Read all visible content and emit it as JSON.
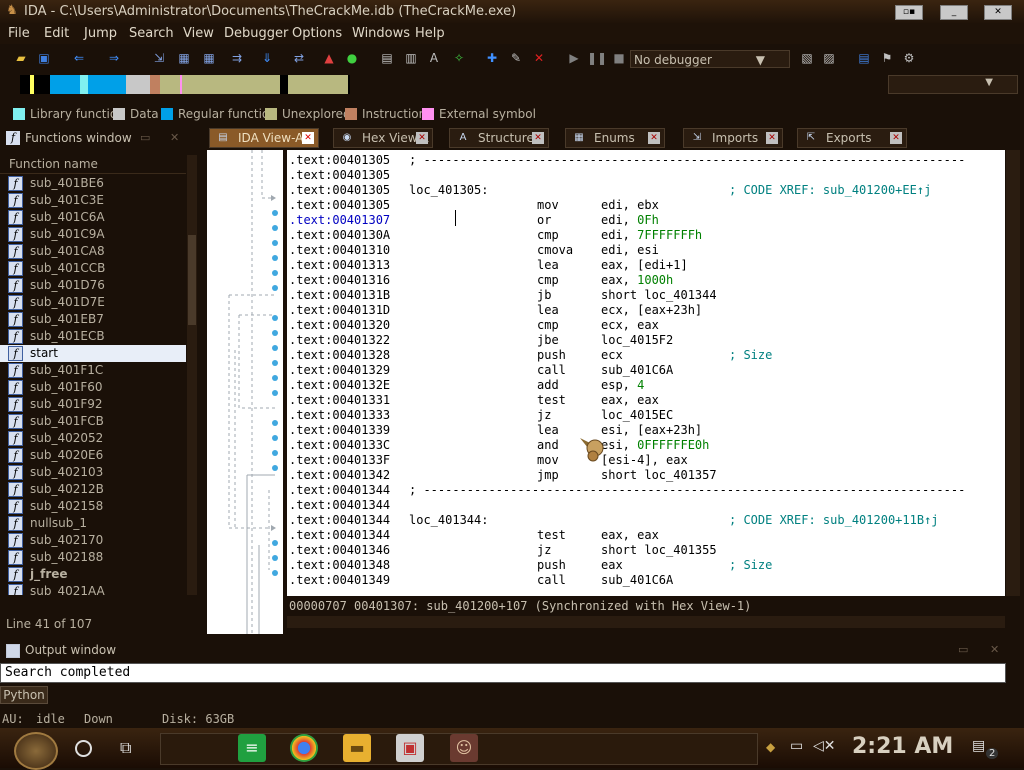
{
  "window": {
    "title": "IDA - C:\\Users\\Administrator\\Documents\\TheCrackMe.idb (TheCrackMe.exe)"
  },
  "menu": [
    "File",
    "Edit",
    "Jump",
    "Search",
    "View",
    "Debugger",
    "Options",
    "Windows",
    "Help"
  ],
  "toolbar": {
    "debugger": "No debugger"
  },
  "legend": [
    {
      "label": "Library function",
      "color": "#80f0f0"
    },
    {
      "label": "Data",
      "color": "#c8c8c8"
    },
    {
      "label": "Regular function",
      "color": "#00a0e8"
    },
    {
      "label": "Unexplored",
      "color": "#b8b880"
    },
    {
      "label": "Instruction",
      "color": "#c08060"
    },
    {
      "label": "External symbol",
      "color": "#ff90f0"
    }
  ],
  "functions": {
    "title": "Functions window",
    "column": "Function name",
    "items": [
      "sub_401BE6",
      "sub_401C3E",
      "sub_401C6A",
      "sub_401C9A",
      "sub_401CA8",
      "sub_401CCB",
      "sub_401D76",
      "sub_401D7E",
      "sub_401EB7",
      "sub_401ECB",
      "start",
      "sub_401F1C",
      "sub_401F60",
      "sub_401F92",
      "sub_401FCB",
      "sub_402052",
      "sub_4020E6",
      "sub_402103",
      "sub_40212B",
      "sub_402158",
      "nullsub_1",
      "sub_402170",
      "sub_402188",
      "j_free",
      "sub_4021AA"
    ],
    "selected_index": 10,
    "line_info": "Line 41 of 107"
  },
  "tabs": [
    {
      "label": "IDA View-A",
      "active": true
    },
    {
      "label": "Hex View-1",
      "active": false
    },
    {
      "label": "Structures",
      "active": false
    },
    {
      "label": "Enums",
      "active": false
    },
    {
      "label": "Imports",
      "active": false
    },
    {
      "label": "Exports",
      "active": false
    }
  ],
  "disasm": [
    {
      "addr": ".text:00401305",
      "sep": "; ---------------------------------------------------------------------------"
    },
    {
      "addr": ".text:00401305"
    },
    {
      "addr": ".text:00401305",
      "label": "loc_401305:",
      "comment": "; CODE XREF: sub_401200+EE↑j"
    },
    {
      "addr": ".text:00401305",
      "mn": "mov",
      "op": "edi, ebx"
    },
    {
      "addr": ".text:00401307",
      "mn": "or",
      "op": "edi, ",
      "num": "0Fh",
      "cursor": true
    },
    {
      "addr": ".text:0040130A",
      "mn": "cmp",
      "op": "edi, ",
      "num": "7FFFFFFFh"
    },
    {
      "addr": ".text:00401310",
      "mn": "cmova",
      "op": "edi, esi"
    },
    {
      "addr": ".text:00401313",
      "mn": "lea",
      "op": "eax, [edi+1]"
    },
    {
      "addr": ".text:00401316",
      "mn": "cmp",
      "op": "eax, ",
      "num": "1000h"
    },
    {
      "addr": ".text:0040131B",
      "mn": "jb",
      "op": "short loc_401344"
    },
    {
      "addr": ".text:0040131D",
      "mn": "lea",
      "op": "ecx, [eax+23h]"
    },
    {
      "addr": ".text:00401320",
      "mn": "cmp",
      "op": "ecx, eax"
    },
    {
      "addr": ".text:00401322",
      "mn": "jbe",
      "op": "loc_4015F2"
    },
    {
      "addr": ".text:00401328",
      "mn": "push",
      "op": "ecx",
      "comment": "; Size"
    },
    {
      "addr": ".text:00401329",
      "mn": "call",
      "op": "sub_401C6A"
    },
    {
      "addr": ".text:0040132E",
      "mn": "add",
      "op": "esp, ",
      "num": "4"
    },
    {
      "addr": ".text:00401331",
      "mn": "test",
      "op": "eax, eax"
    },
    {
      "addr": ".text:00401333",
      "mn": "jz",
      "op": "loc_4015EC"
    },
    {
      "addr": ".text:00401339",
      "mn": "lea",
      "op": "esi, [eax+23h]"
    },
    {
      "addr": ".text:0040133C",
      "mn": "and",
      "op": "esi, ",
      "num": "0FFFFFFE0h"
    },
    {
      "addr": ".text:0040133F",
      "mn": "mov",
      "op": "[esi-4], eax"
    },
    {
      "addr": ".text:00401342",
      "mn": "jmp",
      "op": "short loc_401357"
    },
    {
      "addr": ".text:00401344",
      "sep": "; ---------------------------------------------------------------------------"
    },
    {
      "addr": ".text:00401344"
    },
    {
      "addr": ".text:00401344",
      "label": "loc_401344:",
      "comment": "; CODE XREF: sub_401200+11B↑j"
    },
    {
      "addr": ".text:00401344",
      "mn": "test",
      "op": "eax, eax"
    },
    {
      "addr": ".text:00401346",
      "mn": "jz",
      "op": "short loc_401355"
    },
    {
      "addr": ".text:00401348",
      "mn": "push",
      "op": "eax",
      "comment": "; Size"
    },
    {
      "addr": ".text:00401349",
      "mn": "call",
      "op": "sub_401C6A"
    }
  ],
  "disasm_status": "00000707 00401307: sub_401200+107 (Synchronized with Hex View-1)",
  "output": {
    "title": "Output window",
    "text": "Search completed",
    "python": "Python"
  },
  "statusbar": {
    "au": "AU:",
    "state": "idle",
    "dir": "Down",
    "disk": "Disk: 63GB"
  },
  "taskbar": {
    "clock": "2:21 AM",
    "notifications": "2"
  }
}
